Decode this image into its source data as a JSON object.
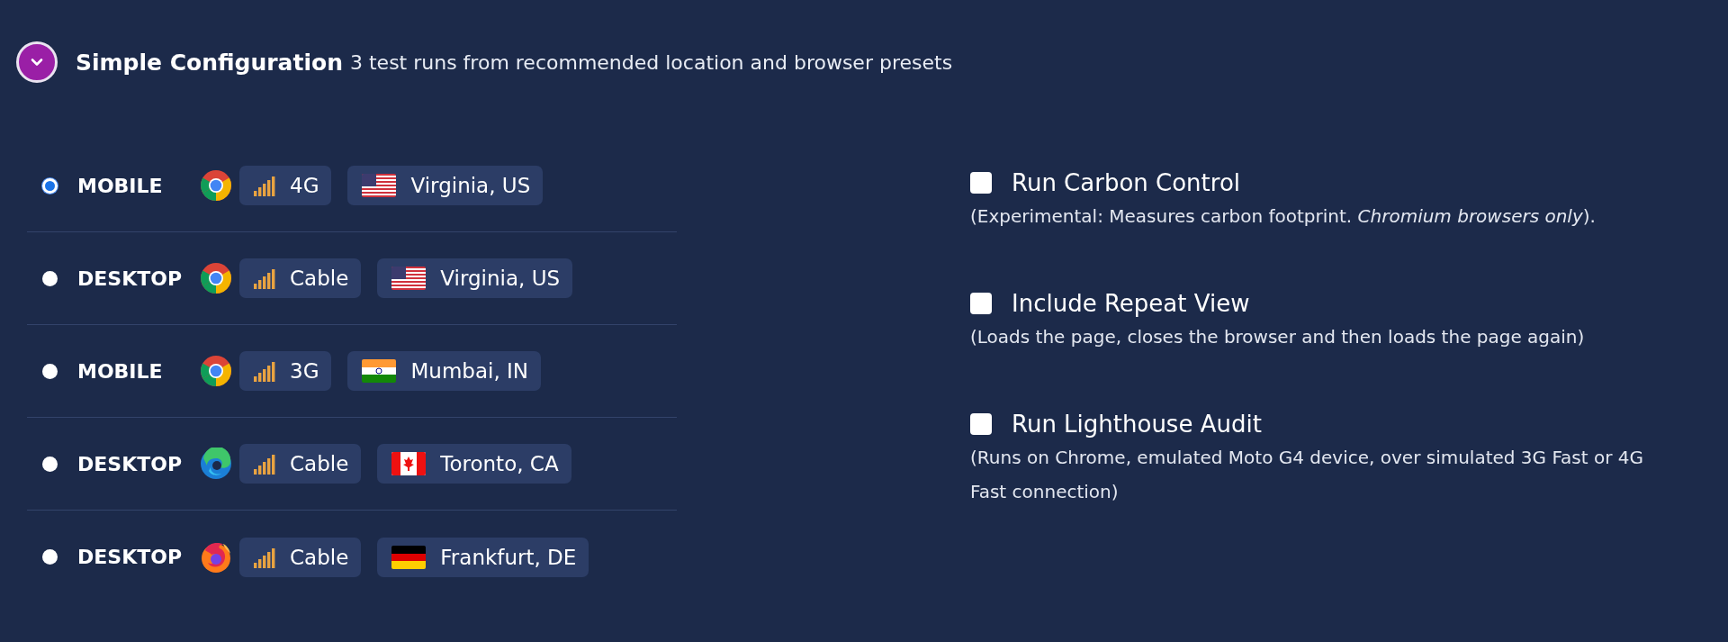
{
  "header": {
    "title": "Simple Configuration",
    "subtitle": "3 test runs from recommended location and browser presets",
    "expanded": true
  },
  "presets": [
    {
      "selected": true,
      "device": "MOBILE",
      "browser": {
        "kind": "chrome"
      },
      "connection": "4G",
      "flag": {
        "kind": "us"
      },
      "location": "Virginia, US"
    },
    {
      "selected": false,
      "device": "DESKTOP",
      "browser": {
        "kind": "chrome"
      },
      "connection": "Cable",
      "flag": {
        "kind": "us"
      },
      "location": "Virginia, US"
    },
    {
      "selected": false,
      "device": "MOBILE",
      "browser": {
        "kind": "chrome"
      },
      "connection": "3G",
      "flag": {
        "kind": "in"
      },
      "location": "Mumbai, IN"
    },
    {
      "selected": false,
      "device": "DESKTOP",
      "browser": {
        "kind": "edge"
      },
      "connection": "Cable",
      "flag": {
        "kind": "ca"
      },
      "location": "Toronto, CA"
    },
    {
      "selected": false,
      "device": "DESKTOP",
      "browser": {
        "kind": "firefox"
      },
      "connection": "Cable",
      "flag": {
        "kind": "de"
      },
      "location": "Frankfurt, DE"
    }
  ],
  "options": [
    {
      "label": "Run Carbon Control",
      "checked": false,
      "description": "(Experimental: Measures carbon footprint. *Chromium browsers only*)."
    },
    {
      "label": "Include Repeat View",
      "checked": false,
      "description": "(Loads the page, closes the browser and then loads the page again)"
    },
    {
      "label": "Run Lighthouse Audit",
      "checked": false,
      "description": "(Runs on Chrome, emulated Moto G4 device, over simulated 3G Fast or 4G Fast connection)"
    }
  ]
}
